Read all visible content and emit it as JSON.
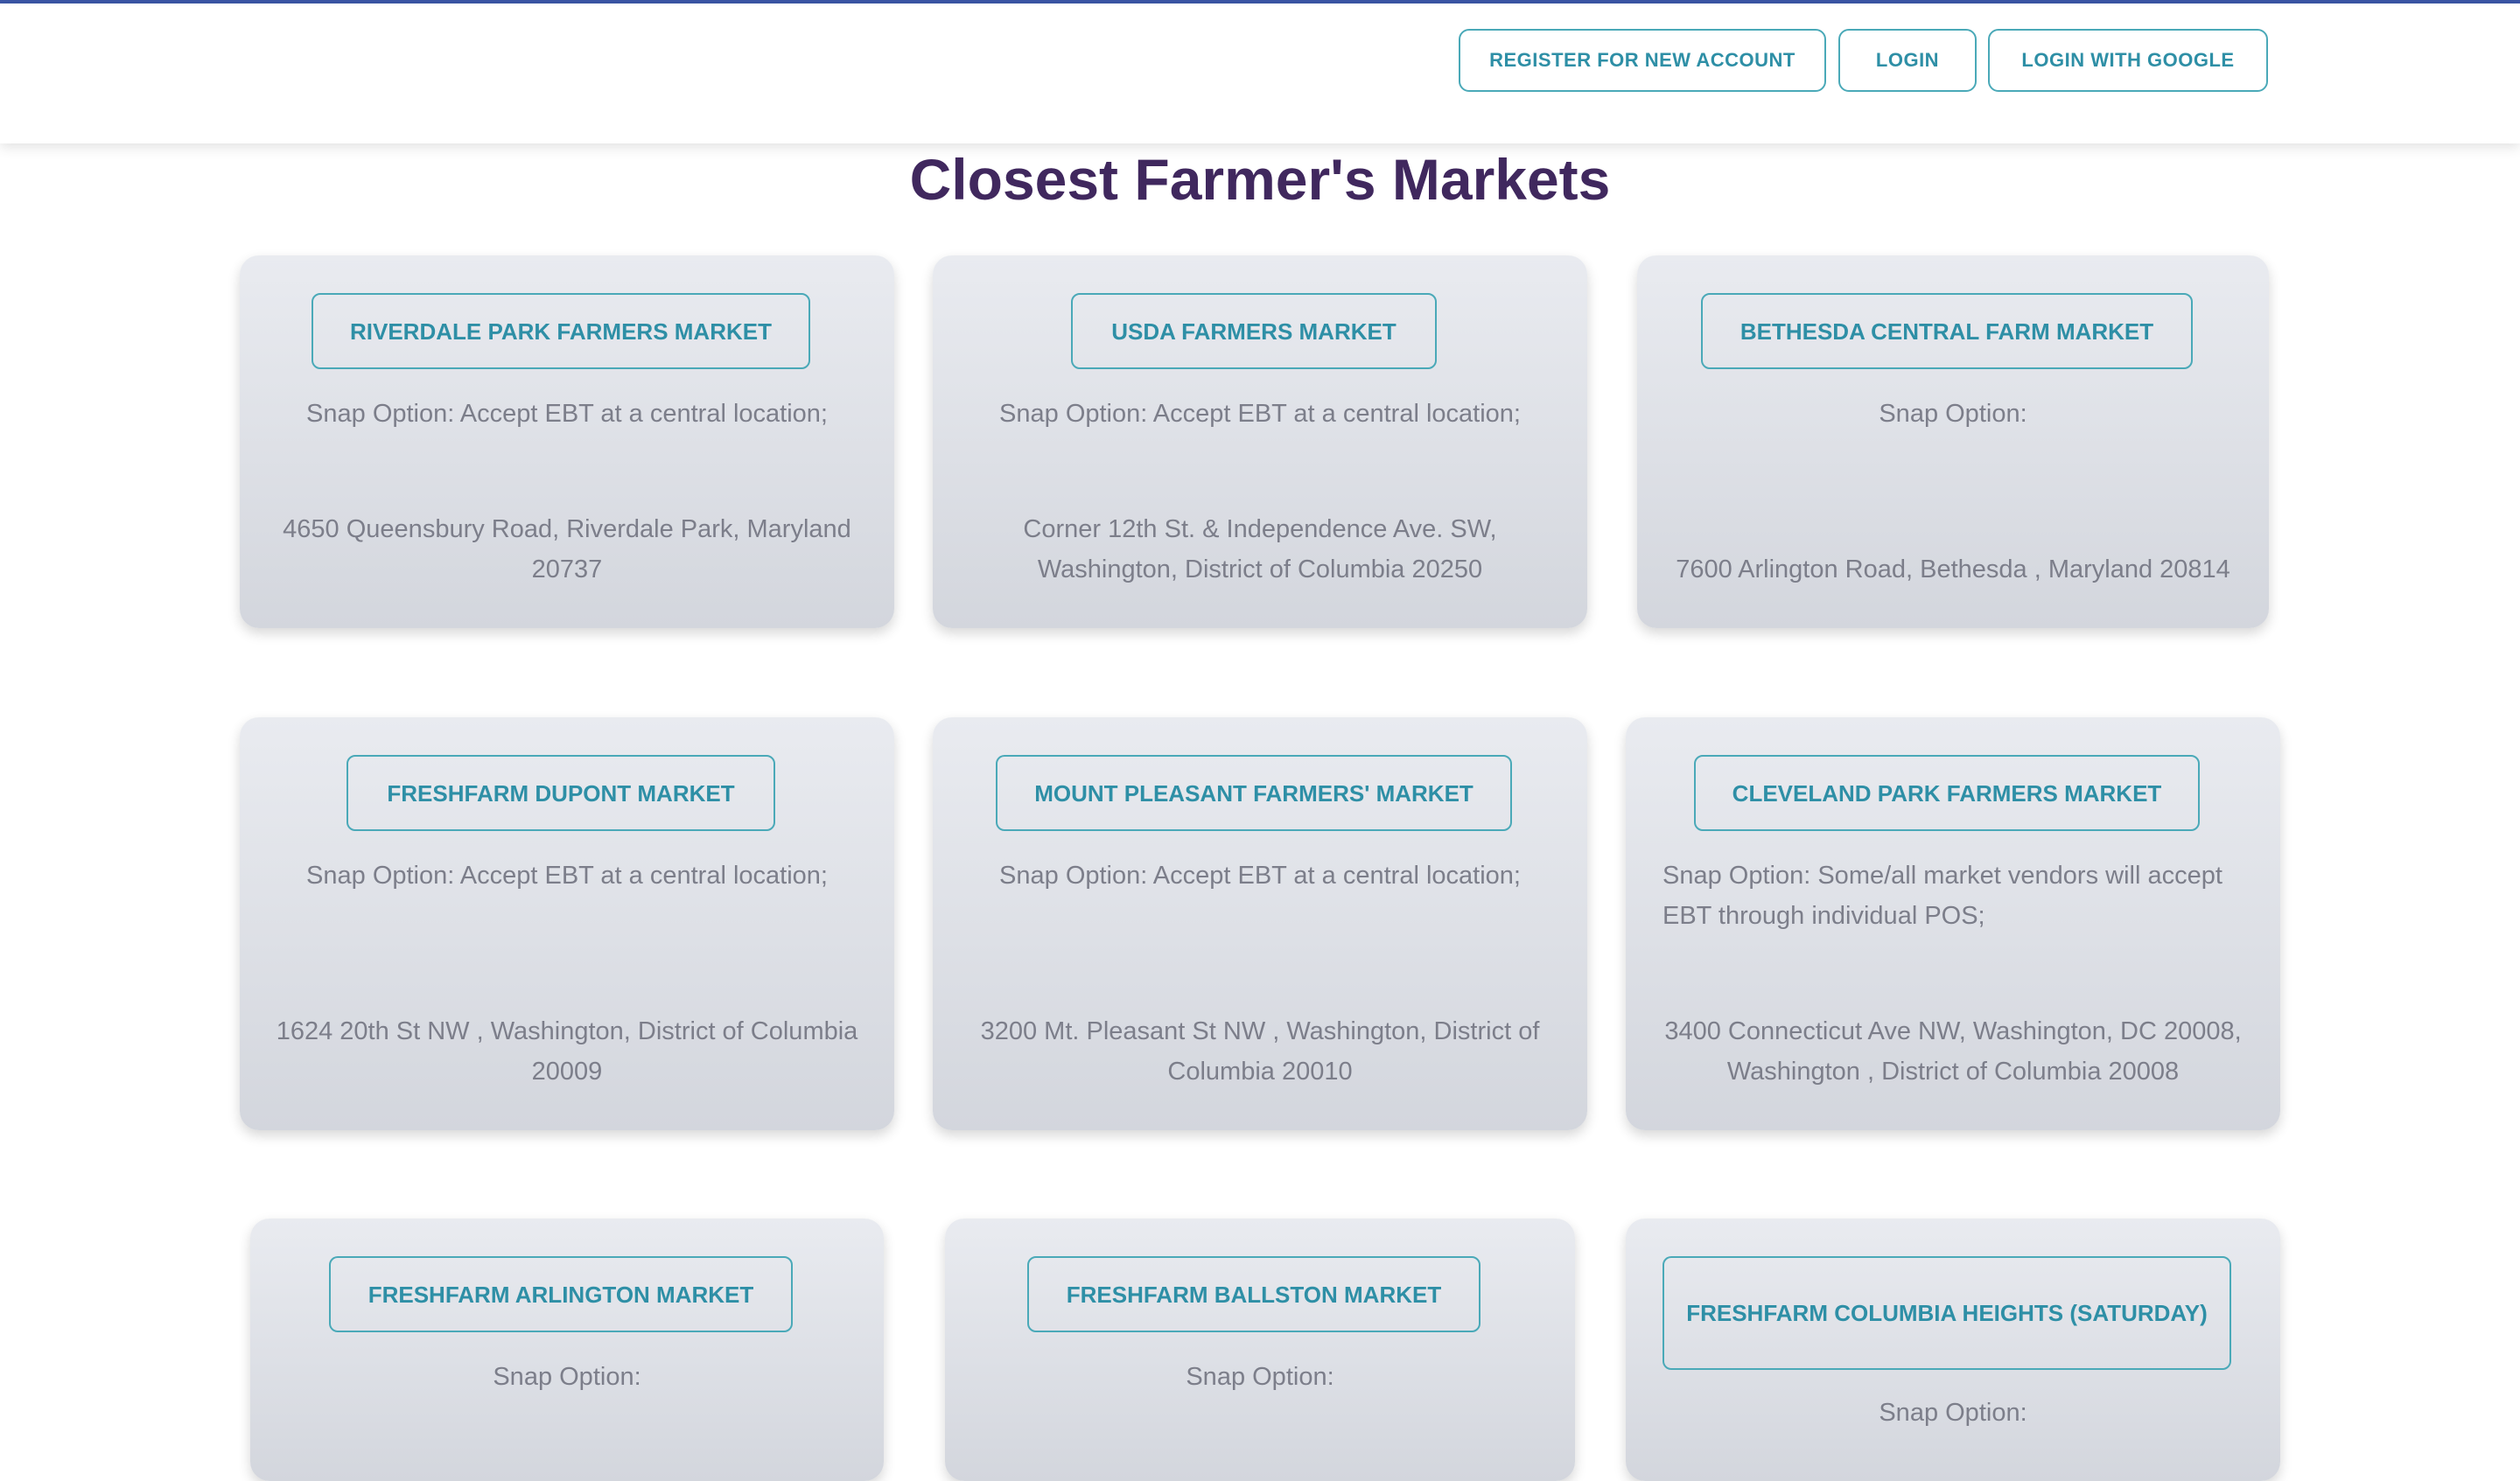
{
  "nav": {
    "register_label": "REGISTER FOR NEW ACCOUNT",
    "login_label": "LOGIN",
    "google_label": "LOGIN WITH GOOGLE"
  },
  "page": {
    "title": "Closest Farmer's Markets"
  },
  "markets": [
    {
      "name": "RIVERDALE PARK FARMERS MARKET",
      "snap": "Snap Option: Accept EBT at a central location;",
      "address": "4650 Queensbury Road, Riverdale Park, Maryland 20737"
    },
    {
      "name": "USDA FARMERS MARKET",
      "snap": "Snap Option: Accept EBT at a central location;",
      "address": "Corner 12th St. & Independence Ave. SW, Washington, District of Columbia 20250"
    },
    {
      "name": "BETHESDA CENTRAL FARM MARKET",
      "snap": "Snap Option:",
      "address": "7600 Arlington Road, Bethesda , Maryland 20814"
    },
    {
      "name": "FRESHFARM DUPONT MARKET",
      "snap": "Snap Option: Accept EBT at a central location;",
      "address": "1624 20th St NW , Washington, District of Columbia 20009"
    },
    {
      "name": "MOUNT PLEASANT FARMERS' MARKET",
      "snap": "Snap Option: Accept EBT at a central location;",
      "address": "3200 Mt. Pleasant St NW , Washington, District of Columbia 20010"
    },
    {
      "name": "CLEVELAND PARK FARMERS MARKET",
      "snap": "Snap Option: Some/all market vendors will accept EBT through individual POS;",
      "address": "3400 Connecticut Ave NW, Washington, DC 20008, Washington , District of Columbia 20008"
    },
    {
      "name": "FRESHFARM ARLINGTON MARKET",
      "snap": "Snap Option:",
      "address": ""
    },
    {
      "name": "FRESHFARM BALLSTON MARKET",
      "snap": "Snap Option:",
      "address": ""
    },
    {
      "name": "FRESHFARM COLUMBIA HEIGHTS (SATURDAY)",
      "snap": "Snap Option:",
      "address": ""
    }
  ]
}
